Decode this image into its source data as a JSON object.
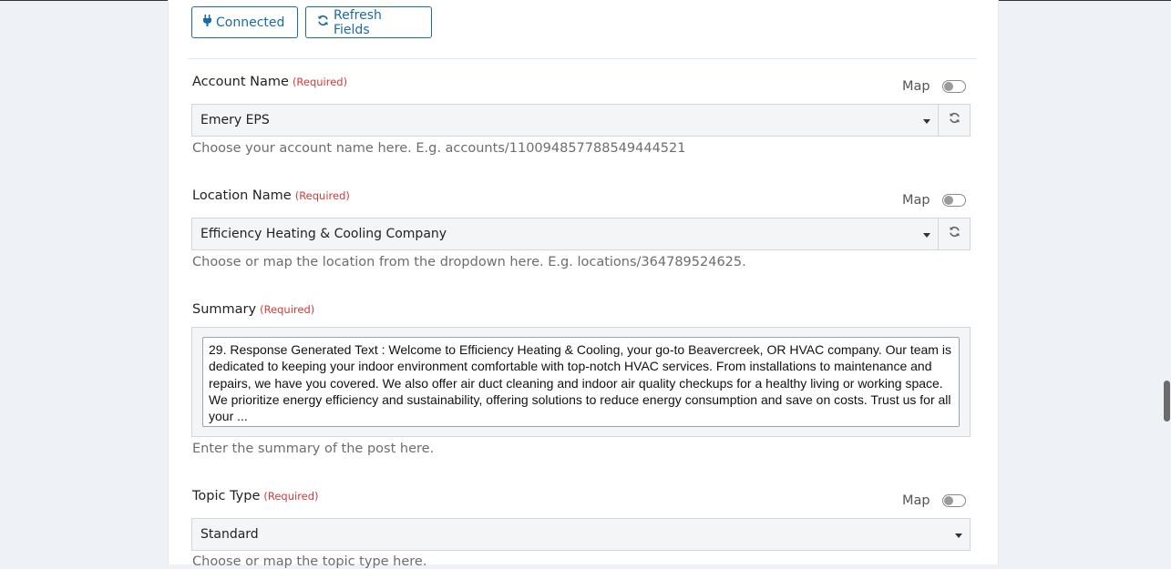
{
  "toolbar": {
    "connected_label": "Connected",
    "refresh_label": "Refresh Fields"
  },
  "fields": {
    "account": {
      "label": "Account Name",
      "required": "(Required)",
      "map_label": "Map",
      "value": "Emery EPS",
      "help": "Choose your account name here. E.g. accounts/110094857788549444521"
    },
    "location": {
      "label": "Location Name",
      "required": "(Required)",
      "map_label": "Map",
      "value": "Efficiency Heating & Cooling Company",
      "help": "Choose or map the location from the dropdown here. E.g. locations/364789524625."
    },
    "summary": {
      "label": "Summary",
      "required": "(Required)",
      "value": "29. Response Generated Text : Welcome to Efficiency Heating & Cooling, your go-to Beavercreek, OR HVAC company. Our team is dedicated to keeping your indoor environment comfortable with top-notch HVAC services. From installations to maintenance and repairs, we have you covered. We also offer air duct cleaning and indoor air quality checkups for a healthy living or working space. We prioritize energy efficiency and sustainability, offering solutions to reduce energy consumption and save on costs. Trust us for all your ...",
      "help": "Enter the summary of the post here."
    },
    "topic": {
      "label": "Topic Type",
      "required": "(Required)",
      "map_label": "Map",
      "value": "Standard",
      "help": "Choose or map the topic type here."
    }
  },
  "icons": {
    "plug": "plug-icon",
    "refresh": "refresh-icon",
    "caret": "caret-down-icon"
  },
  "colors": {
    "accent": "#1a6aa6",
    "required": "#d13b3b"
  }
}
